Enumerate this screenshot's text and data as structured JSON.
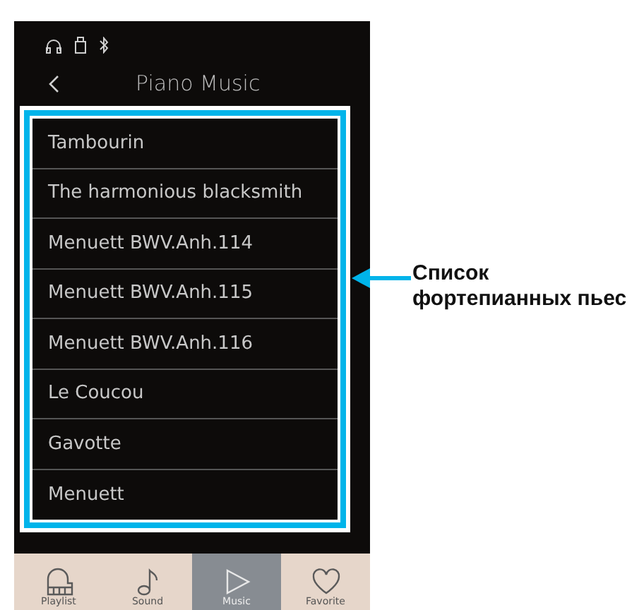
{
  "header": {
    "title": "Piano Music"
  },
  "songs": [
    {
      "title": "Tambourin"
    },
    {
      "title": "The harmonious blacksmith"
    },
    {
      "title": "Menuett BWV.Anh.114"
    },
    {
      "title": "Menuett BWV.Anh.115"
    },
    {
      "title": "Menuett BWV.Anh.116"
    },
    {
      "title": "Le Coucou"
    },
    {
      "title": "Gavotte"
    },
    {
      "title": "Menuett"
    }
  ],
  "tabs": [
    {
      "label": "Playlist",
      "kind": "piano",
      "selected": false
    },
    {
      "label": "Sound",
      "kind": "note",
      "selected": false
    },
    {
      "label": "Music",
      "kind": "play",
      "selected": true
    },
    {
      "label": "Favorite",
      "kind": "heart",
      "selected": false
    }
  ],
  "callout": {
    "text": "Список фортепианных пьес"
  }
}
